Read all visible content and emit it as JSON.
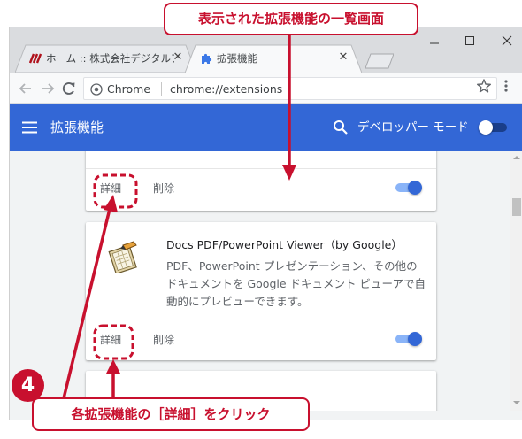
{
  "browser": {
    "tabs": [
      {
        "title": "ホーム :: 株式会社デジタルアドバンテージ"
      },
      {
        "title": "拡張機能"
      }
    ],
    "omnibox": {
      "label": "Chrome",
      "url": "chrome://extensions"
    }
  },
  "extensions_page": {
    "title": "拡張機能",
    "dev_mode_label": "デベロッパー モード"
  },
  "cards": [
    {
      "details_label": "詳細",
      "remove_label": "削除",
      "enabled": true
    },
    {
      "name": "Docs PDF/PowerPoint Viewer（by Google）",
      "description": "PDF、PowerPoint プレゼンテーション、その他のドキュメントを Google ドキュメント ビューアで自動的にプレビューできます。",
      "details_label": "詳細",
      "remove_label": "削除",
      "enabled": true
    }
  ],
  "annotations": {
    "top_callout": "表示された拡張機能の一覧画面",
    "step_number": "4",
    "bottom_callout": "各拡張機能の［詳細］をクリック"
  },
  "colors": {
    "header": "#3367d6",
    "annotation": "#c8102e",
    "toggle_on": "#3367d6"
  },
  "icons": [
    "favicon-digital-advantage-icon",
    "extensions-puzzle-icon",
    "close-icon",
    "back-arrow-icon",
    "forward-arrow-icon",
    "reload-icon",
    "secure-info-icon",
    "star-icon",
    "menu-dots-icon",
    "hamburger-menu-icon",
    "search-icon",
    "docs-viewer-icon"
  ]
}
